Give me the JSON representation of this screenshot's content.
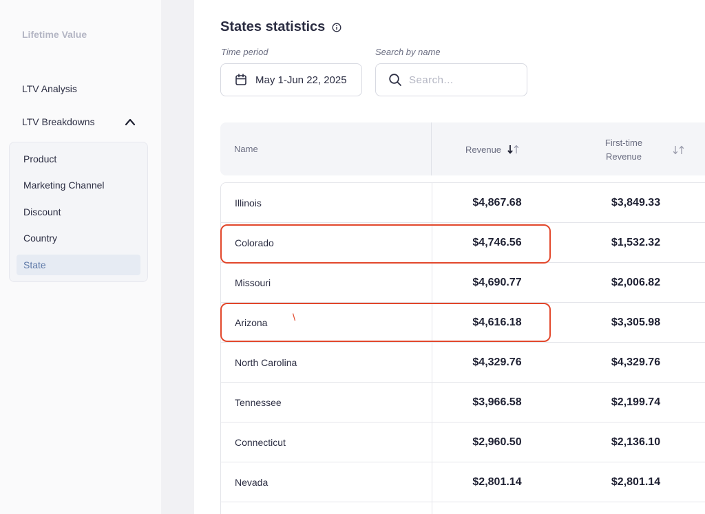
{
  "sidebar": {
    "brand": "Lifetime Value",
    "ltv_analysis": "LTV Analysis",
    "ltv_breakdowns": "LTV Breakdowns",
    "sub_items": [
      {
        "label": "Product",
        "active": false
      },
      {
        "label": "Marketing Channel",
        "active": false
      },
      {
        "label": "Discount",
        "active": false
      },
      {
        "label": "Country",
        "active": false
      },
      {
        "label": "State",
        "active": true
      }
    ]
  },
  "header": {
    "title": "States statistics",
    "info_icon": "info-icon"
  },
  "filters": {
    "time_period_label": "Time period",
    "date_range": "May 1-Jun 22, 2025",
    "search_label": "Search by name",
    "search_placeholder": "Search..."
  },
  "table": {
    "columns": {
      "name": "Name",
      "revenue": "Revenue",
      "first_time_revenue_line1": "First-time",
      "first_time_revenue_line2": "Revenue"
    },
    "rows": [
      {
        "name": "Illinois",
        "revenue": "$4,867.68",
        "first_time_revenue": "$3,849.33"
      },
      {
        "name": "Colorado",
        "revenue": "$4,746.56",
        "first_time_revenue": "$1,532.32"
      },
      {
        "name": "Missouri",
        "revenue": "$4,690.77",
        "first_time_revenue": "$2,006.82"
      },
      {
        "name": "Arizona",
        "revenue": "$4,616.18",
        "first_time_revenue": "$3,305.98"
      },
      {
        "name": "North Carolina",
        "revenue": "$4,329.76",
        "first_time_revenue": "$4,329.76"
      },
      {
        "name": "Tennessee",
        "revenue": "$3,966.58",
        "first_time_revenue": "$2,199.74"
      },
      {
        "name": "Connecticut",
        "revenue": "$2,960.50",
        "first_time_revenue": "$2,136.10"
      },
      {
        "name": "Nevada",
        "revenue": "$2,801.14",
        "first_time_revenue": "$2,801.14"
      }
    ]
  },
  "colors": {
    "highlight": "#e2472b",
    "active_nav_bg": "#e6ebf3",
    "active_nav_text": "#5e79a8"
  }
}
